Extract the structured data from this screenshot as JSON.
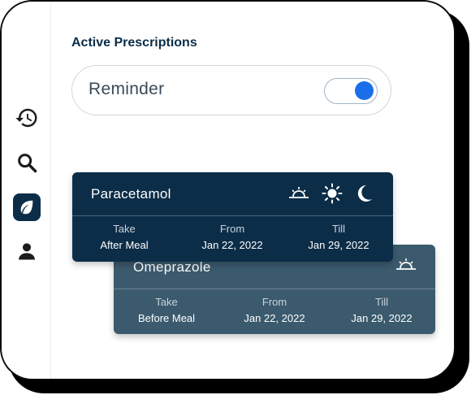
{
  "section_title": "Active Prescriptions",
  "reminder": {
    "label": "Reminder",
    "enabled": true
  },
  "sidebar": {
    "items": [
      {
        "icon": "history-icon",
        "active": false
      },
      {
        "icon": "search-icon",
        "active": false
      },
      {
        "icon": "leaf-icon",
        "active": true
      },
      {
        "icon": "user-icon",
        "active": false
      }
    ]
  },
  "prescriptions": [
    {
      "name": "Paracetamol",
      "times": [
        "sunrise-icon",
        "sun-icon",
        "moon-icon"
      ],
      "take_label": "Take",
      "take_value": "After Meal",
      "from_label": "From",
      "from_value": "Jan 22, 2022",
      "till_label": "Till",
      "till_value": "Jan 29, 2022"
    },
    {
      "name": "Omeprazole",
      "times": [
        "sunrise-icon"
      ],
      "take_label": "Take",
      "take_value": "Before Meal",
      "from_label": "From",
      "from_value": "Jan 22, 2022",
      "till_label": "Till",
      "till_value": "Jan 29, 2022"
    }
  ],
  "colors": {
    "primary": "#0c2d48",
    "card_secondary": "#3b5a6d",
    "toggle_accent": "#1a6fe8"
  }
}
